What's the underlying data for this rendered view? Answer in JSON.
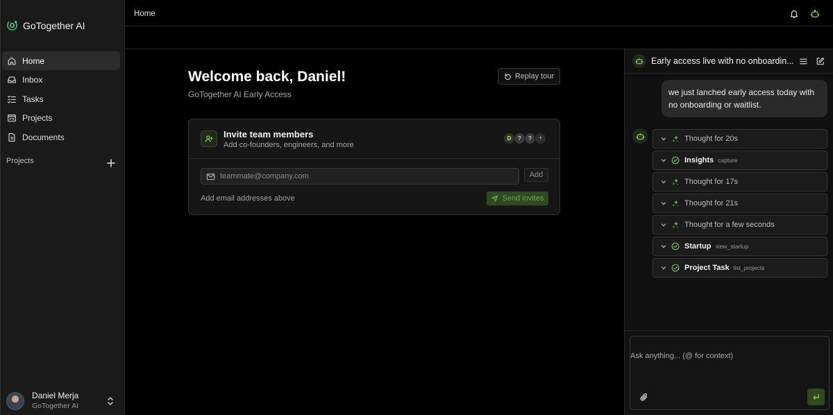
{
  "app": {
    "name": "GoTogether AI"
  },
  "sidebar": {
    "items": [
      {
        "label": "Home",
        "icon": "home-icon",
        "active": true
      },
      {
        "label": "Inbox",
        "icon": "inbox-icon"
      },
      {
        "label": "Tasks",
        "icon": "tasks-icon"
      },
      {
        "label": "Projects",
        "icon": "projects-icon"
      },
      {
        "label": "Documents",
        "icon": "documents-icon"
      }
    ],
    "section_label": "Projects",
    "user": {
      "name": "Daniel Merja",
      "org": "GoTogether AI"
    }
  },
  "topbar": {
    "breadcrumb": "Home"
  },
  "main": {
    "welcome": "Welcome back, Daniel!",
    "subtitle": "GoTogether AI Early Access",
    "replay_label": "Replay tour",
    "invite": {
      "title": "Invite team members",
      "description": "Add co-founders, engineers, and more",
      "avatars": [
        "D",
        "?",
        "?",
        "+"
      ],
      "email_placeholder": "teammate@company.com",
      "add_label": "Add",
      "hint": "Add email addresses above",
      "send_label": "Send invites"
    }
  },
  "chat": {
    "title": "Early access live with no onboardin...",
    "user_message": "we just lanched early access today with no onboarding or waitlist.",
    "steps": [
      {
        "kind": "thought",
        "label": "Thought for 20s"
      },
      {
        "kind": "tool",
        "label": "Insights",
        "tag": "capture"
      },
      {
        "kind": "thought",
        "label": "Thought for 17s"
      },
      {
        "kind": "thought",
        "label": "Thought for 21s"
      },
      {
        "kind": "thought",
        "label": "Thought for a few seconds"
      },
      {
        "kind": "tool",
        "label": "Startup",
        "tag": "view_startup"
      },
      {
        "kind": "tool",
        "label": "Project Task",
        "tag": "list_projects"
      }
    ],
    "composer_placeholder": "Ask anything... (@ for context)"
  },
  "colors": {
    "accent": "#8fd46a",
    "accent_bg": "#2f4a22",
    "background": "#000000",
    "sidebar": "#1a1a1a"
  }
}
